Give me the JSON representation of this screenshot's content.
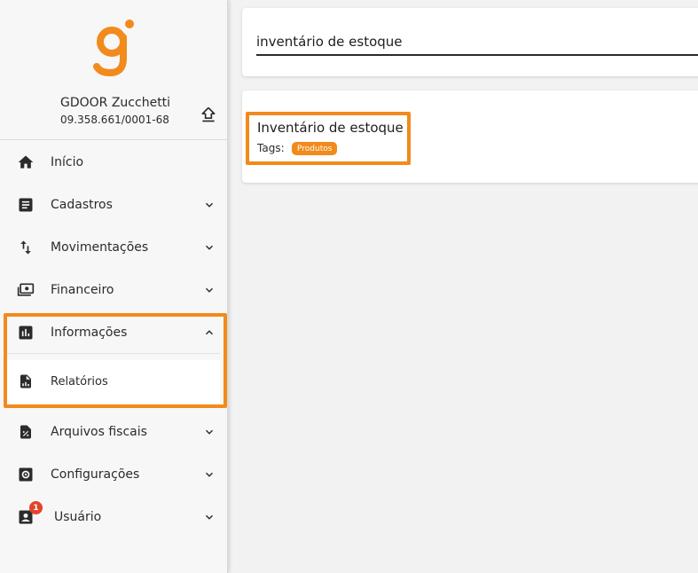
{
  "brand": {
    "accent_color": "#f28a1c",
    "logo_icon": "g-logo-icon"
  },
  "company": {
    "name": "GDOOR Zucchetti",
    "cnpj": "09.358.661/0001-68"
  },
  "sidebar": {
    "items": [
      {
        "label": "Início",
        "icon": "home-icon"
      },
      {
        "label": "Cadastros",
        "icon": "document-icon"
      },
      {
        "label": "Movimentações",
        "icon": "swap-vertical-icon"
      },
      {
        "label": "Financeiro",
        "icon": "money-icon"
      },
      {
        "label": "Informações",
        "icon": "bar-chart-icon",
        "expanded": true
      },
      {
        "label": "Arquivos fiscais",
        "icon": "file-percent-icon"
      },
      {
        "label": "Configurações",
        "icon": "settings-icon"
      },
      {
        "label": "Usuário",
        "icon": "user-icon",
        "badge": "1"
      }
    ],
    "sub_items": [
      {
        "label": "Relatórios",
        "icon": "report-file-icon"
      }
    ]
  },
  "search": {
    "value": "inventário de estoque"
  },
  "results": [
    {
      "title": "Inventário de estoque",
      "tags_label": "Tags:",
      "tags": [
        "Produtos"
      ]
    }
  ]
}
